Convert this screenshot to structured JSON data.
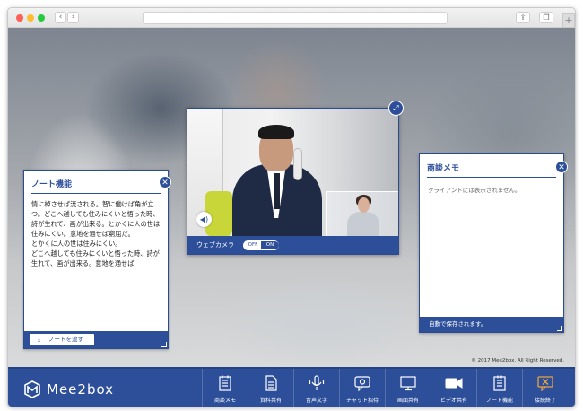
{
  "app": {
    "copyright": "© 2017 Mee2box. All Right Reserved.",
    "brand": "Mee2box",
    "accent_color": "#2d4f9a",
    "end_icon_color": "#e8a444"
  },
  "note_panel": {
    "title": "ノート機能",
    "body": "情に棹させば流される。智に働けば角が立つ。どこへ越しても住みにくいと悟った時、詩が生れて、画が出来る。とかくに人の世は住みにくい。意地を通せば窮屈だ。\nとかくに人の世は住みにくい。\nどこへ越しても住みにくいと悟った時、詩が生れて、画が出来る。意地を通せば",
    "share_button": "ノートを渡す",
    "close": "✕"
  },
  "memo_panel": {
    "title": "商談メモ",
    "body": "クライアントには表示されません。",
    "footer": "自動で保存されます。",
    "close": "✕"
  },
  "video_panel": {
    "webcam_label": "ウェブカメラ",
    "toggle_off": "OFF",
    "toggle_on": "ON"
  },
  "toolbar": {
    "items": [
      {
        "label": "商談メモ",
        "icon": "memo-icon"
      },
      {
        "label": "資料共有",
        "icon": "document-icon"
      },
      {
        "label": "音声文字",
        "icon": "microphone-icon"
      },
      {
        "label": "チャット招待",
        "icon": "chat-icon"
      },
      {
        "label": "画面共有",
        "icon": "monitor-icon"
      },
      {
        "label": "ビデオ共有",
        "icon": "video-camera-icon"
      },
      {
        "label": "ノート機能",
        "icon": "note-icon"
      },
      {
        "label": "接続終了",
        "icon": "disconnect-icon"
      }
    ]
  }
}
